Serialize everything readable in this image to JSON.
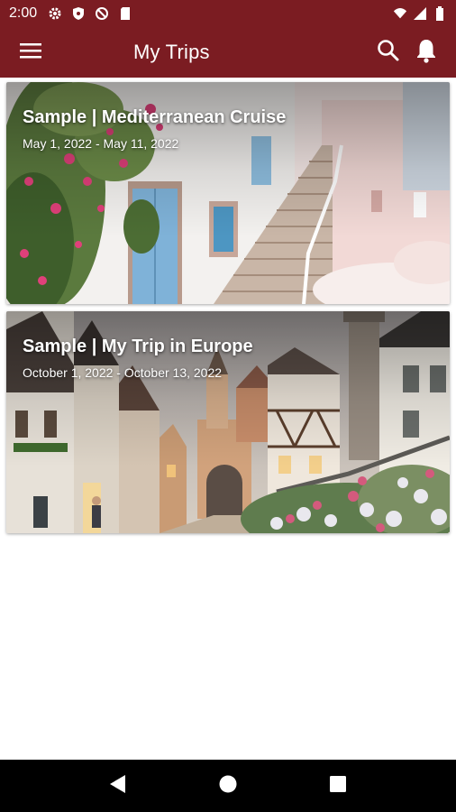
{
  "status_bar": {
    "time": "2:00",
    "left_icons": [
      "gear-icon",
      "shield-icon",
      "no-disturb-icon",
      "sd-card-icon"
    ],
    "right_icons": [
      "wifi-icon",
      "signal-icon",
      "battery-icon"
    ]
  },
  "app_bar": {
    "title": "My Trips",
    "background_color": "#7b1c22",
    "menu_icon": "menu-icon",
    "search_icon": "search-icon",
    "notifications_icon": "bell-icon"
  },
  "trips": [
    {
      "title": "Sample | Mediterranean Cruise",
      "dates": "May 1, 2022 - May 11, 2022"
    },
    {
      "title": "Sample | My Trip in Europe",
      "dates": "October 1, 2022 - October 13, 2022"
    }
  ],
  "nav_bar": {
    "back_icon": "back-triangle-icon",
    "home_icon": "home-circle-icon",
    "recents_icon": "recents-square-icon"
  }
}
